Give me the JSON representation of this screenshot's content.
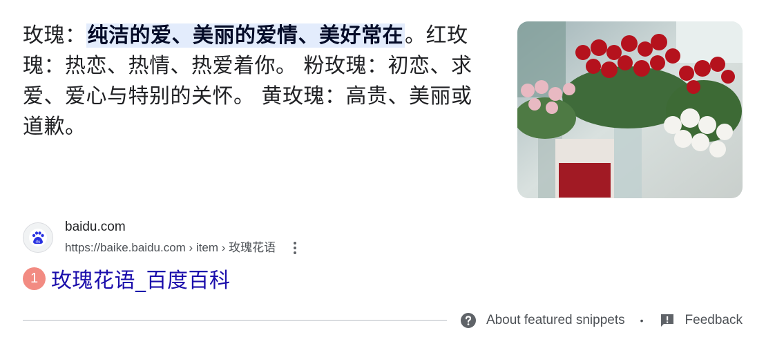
{
  "snippet": {
    "prefix": "玫瑰：",
    "highlight": "纯洁的爱、美丽的爱情、美好常在",
    "highlight_end": "。",
    "rest": "红玫瑰：热恋、热情、热爱着你。 粉玫瑰：初恋、求爱、爱心与特别的关怀。 黄玫瑰：高贵、美丽或道歉。"
  },
  "source": {
    "site_name": "baidu.com",
    "url": "https://baike.baidu.com › item › 玫瑰花语",
    "favicon_label": "du"
  },
  "result": {
    "rank": "1",
    "title": "玫瑰花语_百度百科"
  },
  "footer": {
    "about_label": "About featured snippets",
    "separator": "•",
    "feedback_label": "Feedback"
  },
  "colors": {
    "highlight_bg": "#e3ecfc",
    "link": "#1a0dab",
    "rank_badge": "#f28b82"
  },
  "icons": [
    "help-circle-icon",
    "feedback-icon",
    "more-vert-icon",
    "baidu-paw-icon"
  ]
}
